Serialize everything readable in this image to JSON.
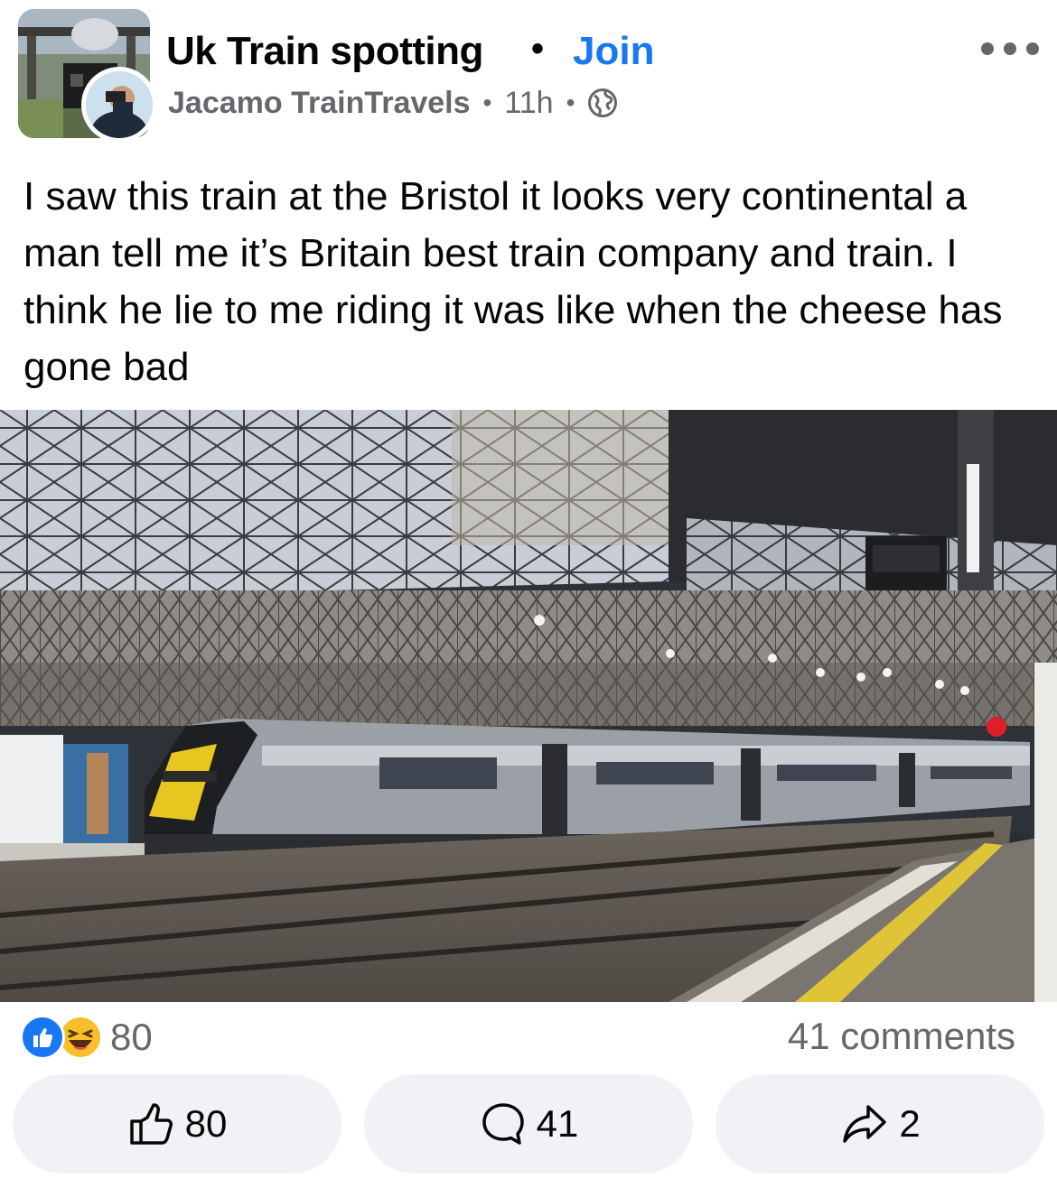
{
  "header": {
    "group_name": "Uk Train spotting",
    "separator": "•",
    "join_label": "Join",
    "author_name": "Jacamo TrainTravels",
    "meta_dot": "•",
    "time": "11h",
    "privacy_icon": "globe-icon",
    "more_icon": "more-options-icon"
  },
  "post": {
    "text": "I saw this train at the Bristol it looks very continental a man tell me it’s Britain best train company and train. I think he lie to me riding it was like when the cheese has gone bad"
  },
  "reactions": {
    "icons": [
      "like-icon",
      "haha-icon"
    ],
    "count": "80",
    "comments_label": "41 comments"
  },
  "actions": {
    "like_count": "80",
    "comment_count": "41",
    "share_count": "2"
  },
  "colors": {
    "accent": "#1877f2",
    "secondary_text": "#65676b",
    "button_bg": "#f0f2f5"
  }
}
